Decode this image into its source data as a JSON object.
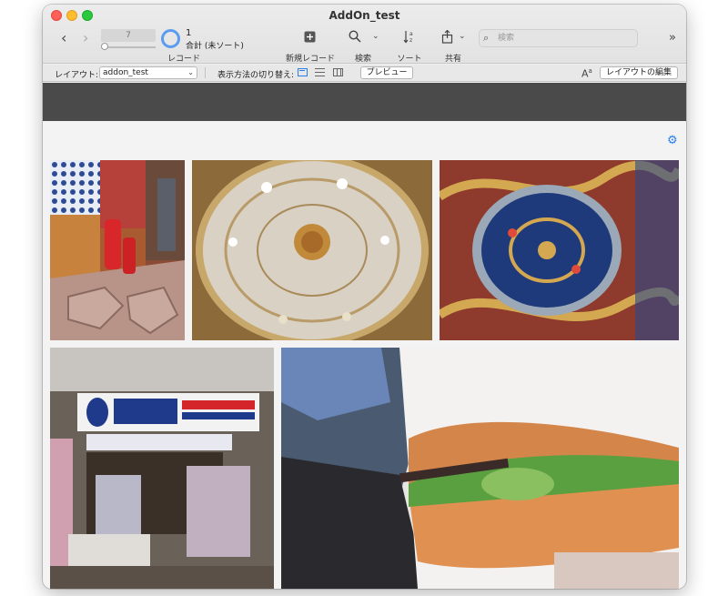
{
  "window": {
    "title": "AddOn_test"
  },
  "toolbar": {
    "record_current": "7",
    "records_label": "レコード",
    "record_count": "1",
    "record_total": "合計 (未ソート)",
    "new_record_label": "新規レコード",
    "find_label": "検索",
    "sort_label": "ソート",
    "share_label": "共有",
    "search_placeholder": "検索"
  },
  "layout_bar": {
    "layout_label": "レイアウト:",
    "layout_value": "addon_test",
    "view_as_label": "表示方法の切り替え:",
    "preview_button": "プレビュー",
    "edit_layout_button": "レイアウトの編集"
  },
  "icons": {
    "prev": "chevron-left-icon",
    "next": "chevron-right-icon",
    "new_record": "plus-square-icon",
    "find": "magnifier-icon",
    "sort": "sort-az-icon",
    "share": "share-icon",
    "search": "search-icon",
    "overflow": "double-chevron-icon",
    "font": "text-size-icon",
    "settings": "gear-icon"
  },
  "colors": {
    "accent": "#2a7fe8",
    "close": "#fe5f57",
    "minimize": "#febc2e",
    "zoom": "#28c840",
    "header_band": "#4a4a4a"
  }
}
